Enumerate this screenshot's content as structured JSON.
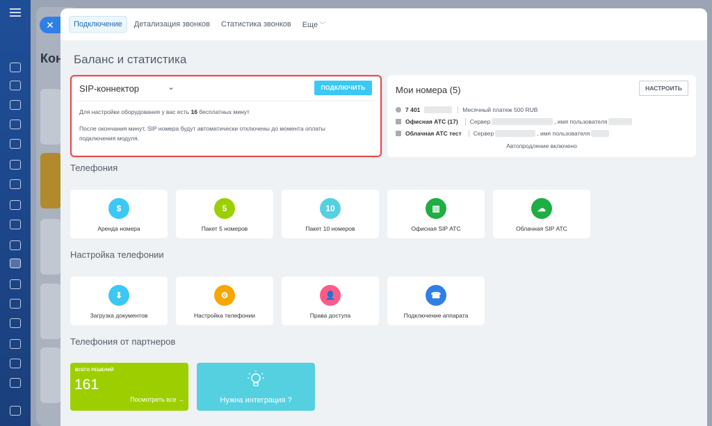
{
  "background": {
    "page_heading": "Кон"
  },
  "close_button": "✕",
  "tabs": [
    {
      "label": "Подключение",
      "active": true
    },
    {
      "label": "Детализация звонков",
      "active": false
    },
    {
      "label": "Статистика звонков",
      "active": false
    },
    {
      "label": "Еще",
      "active": false
    }
  ],
  "page_title": "Баланс и статистика",
  "sip": {
    "title": "SIP-коннектор",
    "connect_button": "ПОДКЛЮЧИТЬ",
    "line1_prefix": "Для настройки оборудования у вас есть",
    "line1_minutes": "16",
    "line1_suffix": "бесплатных минут",
    "line2": "После окончания минут, SIP номера будут автоматически отключены до момента оплаты подключения модуля."
  },
  "numbers": {
    "title": "Мои номера (5)",
    "configure_button": "НАСТРОИТЬ",
    "row1_number": "7 401",
    "row1_payment": "Месячный платеж 500 RUB",
    "row2_name": "Офисная АТС (17)",
    "row2_server": "Сервер",
    "row2_user": ", имя пользователя",
    "row3_name": "Облачная АТС тест",
    "row3_server": "Сервер",
    "row3_user": ", имя пользователя",
    "autorenew": "Автопродление включено"
  },
  "sections": {
    "telephony": "Телефония",
    "settings": "Настройка телефонии",
    "partners": "Телефония от партнеров"
  },
  "telephony_tiles": [
    {
      "label": "Аренда номера",
      "icon": "phone-rent-icon",
      "color": "#3bc8f5",
      "glyph": "$"
    },
    {
      "label": "Пакет 5 номеров",
      "icon": "package-5-icon",
      "color": "#9dcf00",
      "glyph": "5"
    },
    {
      "label": "Пакет 10 номеров",
      "icon": "package-10-icon",
      "color": "#55d0e0",
      "glyph": "10"
    },
    {
      "label": "Офисная SIP АТС",
      "icon": "office-pbx-icon",
      "color": "#1eae43",
      "glyph": "▥"
    },
    {
      "label": "Облачная SIP АТС",
      "icon": "cloud-pbx-icon",
      "color": "#1eae43",
      "glyph": "☁"
    }
  ],
  "settings_tiles": [
    {
      "label": "Загрузка документов",
      "icon": "document-upload-icon",
      "color": "#3bc8f5",
      "glyph": "⬇"
    },
    {
      "label": "Настройка телефонии",
      "icon": "telephony-settings-icon",
      "color": "#f7a700",
      "glyph": "⚙"
    },
    {
      "label": "Права доступа",
      "icon": "access-rights-icon",
      "color": "#ff5b8a",
      "glyph": "👤"
    },
    {
      "label": "Подключение аппарата",
      "icon": "device-connect-icon",
      "color": "#2f7fe6",
      "glyph": "☎"
    }
  ],
  "partners": {
    "total_caption": "ВСЕГО РЕШЕНИЙ",
    "total_count": "161",
    "view_all": "Посмотреть все →",
    "integration": "Нужна интеграция ?"
  }
}
